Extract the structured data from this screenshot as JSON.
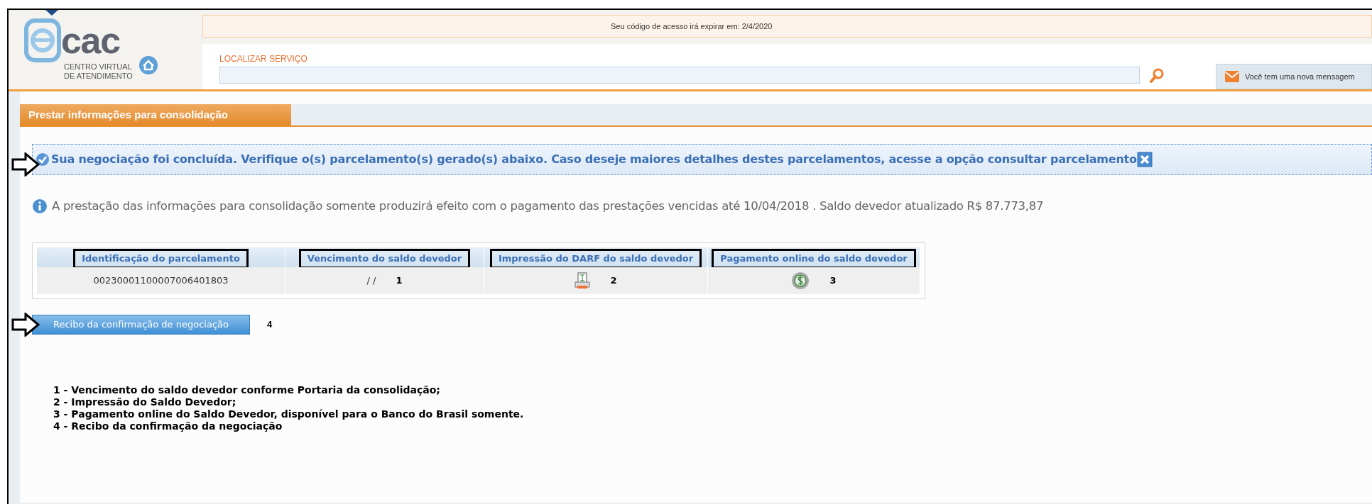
{
  "header": {
    "logo": {
      "mark": "cac",
      "line_1": "CENTRO VIRTUAL",
      "line_2": "DE ATENDIMENTO"
    },
    "notice": "Seu código de acesso irá expirar em: 2/4/2020",
    "search": {
      "label": "LOCALIZAR SERVIÇO"
    },
    "message_button": "Você tem uma nova mensagem"
  },
  "tab": {
    "label": "Prestar informações para consolidação",
    "selected": true
  },
  "success_banner": "Sua negociação foi concluída. Verifique o(s) parcelamento(s) gerado(s) abaixo. Caso deseje maiores detalhes destes parcelamentos, acesse a opção consultar parcelamento",
  "info": "A prestação das informações para consolidação somente produzirá efeito com o pagamento das prestações vencidas até 10/04/2018 . Saldo devedor atualizado R$ 87.773,87",
  "table": {
    "columns": [
      "Identificação do parcelamento",
      "Vencimento do saldo devedor",
      "Impressão do DARF do saldo devedor",
      "Pagamento online do saldo devedor"
    ],
    "rows": [
      {
        "id": "00230001100007006401803",
        "due": "/ /",
        "due_note": "1",
        "print_note": "2",
        "pay_note": "3"
      }
    ]
  },
  "receipt_button": {
    "label": "Recibo da confirmação de negociação",
    "note": "4"
  },
  "notes": [
    "1 - Vencimento do saldo devedor conforme Portaria da consolidação;",
    "2 - Impressão do Saldo Devedor;",
    "3 - Pagamento online do Saldo Devedor, disponível para o Banco do Brasil somente.",
    "4 - Recibo da confirmação da negociação"
  ]
}
